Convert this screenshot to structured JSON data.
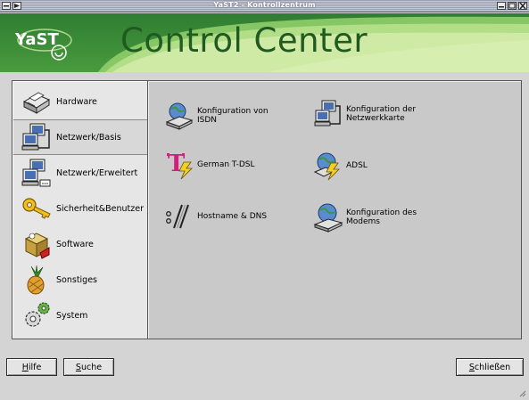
{
  "window": {
    "title": "YaST2 - Kontrollzentrum"
  },
  "banner": {
    "logo_text": "YaST",
    "brand_title": "Control Center"
  },
  "sidebar": {
    "items": [
      {
        "label": "Hardware",
        "icon": "printer-icon",
        "active": false
      },
      {
        "label": "Netzwerk/Basis",
        "icon": "network-computer-icon",
        "active": true
      },
      {
        "label": "Netzwerk/Erweitert",
        "icon": "network-advanced-icon",
        "active": false
      },
      {
        "label": "Sicherheit&Benutzer",
        "icon": "key-icon",
        "active": false
      },
      {
        "label": "Software",
        "icon": "software-package-icon",
        "active": false
      },
      {
        "label": "Sonstiges",
        "icon": "pineapple-icon",
        "active": false
      },
      {
        "label": "System",
        "icon": "gears-icon",
        "active": false
      }
    ]
  },
  "modules": [
    {
      "label_line1": "Konfiguration von",
      "label_line2": "ISDN",
      "icon": "isdn-globe-icon"
    },
    {
      "label_line1": "Konfiguration der",
      "label_line2": "Netzwerkkarte",
      "icon": "network-card-icon"
    },
    {
      "label_line1": "German T-DSL",
      "label_line2": "",
      "icon": "tdsl-icon"
    },
    {
      "label_line1": "ADSL",
      "label_line2": "",
      "icon": "adsl-globe-icon"
    },
    {
      "label_line1": "Hostname & DNS",
      "label_line2": "",
      "icon": "hostname-dns-icon"
    },
    {
      "label_line1": "Konfiguration des",
      "label_line2": "Modems",
      "icon": "modem-globe-icon"
    }
  ],
  "buttons": {
    "help_hotkey": "H",
    "help_rest": "ilfe",
    "search_hotkey": "S",
    "search_rest": "uche",
    "close_hotkey": "S",
    "close_rest": "chließen"
  },
  "colors": {
    "banner_green": "#3e8f38",
    "brand_text": "#1f5a22",
    "panel_bg": "#c9c9c9",
    "sidebar_bg": "#e6e6e6"
  }
}
